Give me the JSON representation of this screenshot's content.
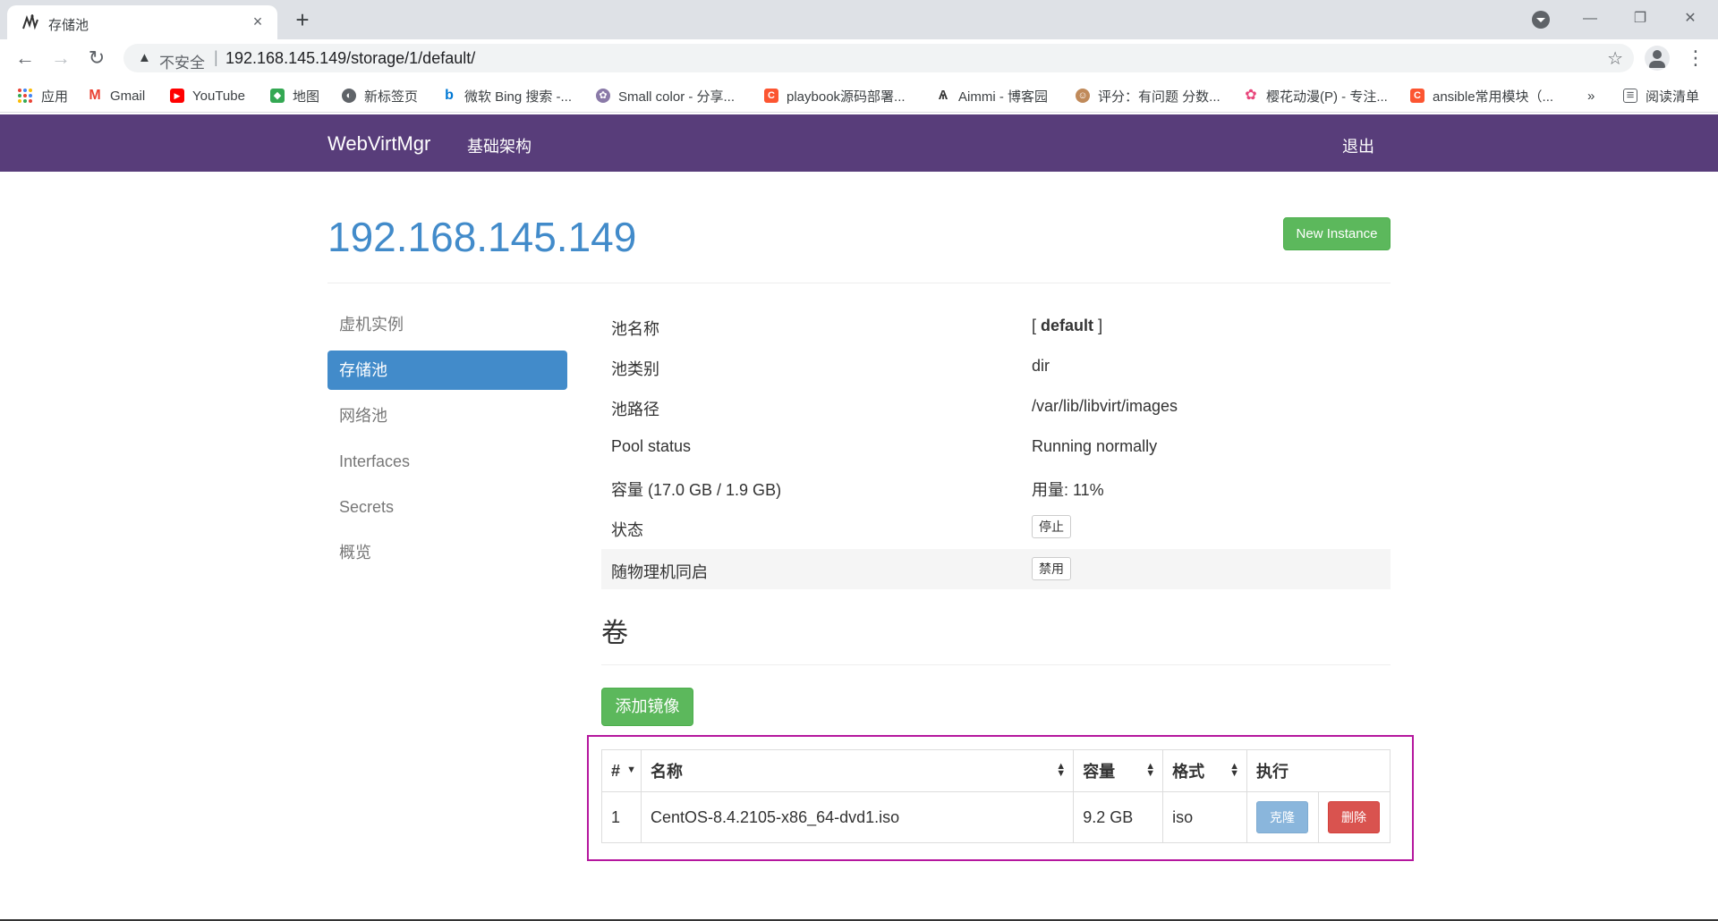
{
  "browser": {
    "tab_title": "存储池",
    "new_tab_symbol": "+",
    "close_symbol": "×",
    "address": {
      "insecure_label": "不安全",
      "separator": "|",
      "url": "192.168.145.149/storage/1/default/"
    },
    "bookmarks": [
      {
        "label": "应用",
        "icon": "apps-grid-icon"
      },
      {
        "label": "Gmail",
        "icon": "gmail-icon",
        "color": "#ea4335"
      },
      {
        "label": "YouTube",
        "icon": "youtube-icon",
        "color": "#ff0000"
      },
      {
        "label": "地图",
        "icon": "maps-icon",
        "color": "#34a853"
      },
      {
        "label": "新标签页",
        "icon": "globe-icon",
        "color": "#5f6368"
      },
      {
        "label": "微软 Bing 搜索 -...",
        "icon": "bing-icon",
        "color": "#0078d4"
      },
      {
        "label": "Small color - 分享...",
        "icon": "small-color-icon",
        "color": "#8a7aa8"
      },
      {
        "label": "playbook源码部署...",
        "icon": "csdn-icon",
        "color": "#fc5531"
      },
      {
        "label": "Aimmi - 博客园",
        "icon": "cnblogs-icon",
        "color": "#333333"
      },
      {
        "label": "评分：有问题 分数...",
        "icon": "avatar-icon",
        "color": "#c08a5a"
      },
      {
        "label": "樱花动漫(P) - 专注...",
        "icon": "sakura-icon",
        "color": "#e8457a"
      },
      {
        "label": "ansible常用模块（...",
        "icon": "csdn-icon",
        "color": "#fc5531"
      }
    ],
    "bookmarks_overflow": "»",
    "reading_list": "阅读清单"
  },
  "navbar": {
    "brand": "WebVirtMgr",
    "infra": "基础架构",
    "logout": "退出",
    "bg_color": "#583d7a"
  },
  "page": {
    "title": "192.168.145.149",
    "new_instance": "New Instance"
  },
  "sidebar": {
    "items": [
      {
        "label": "虚机实例",
        "active": false
      },
      {
        "label": "存储池",
        "active": true
      },
      {
        "label": "网络池",
        "active": false
      },
      {
        "label": "Interfaces",
        "active": false
      },
      {
        "label": "Secrets",
        "active": false
      },
      {
        "label": "概览",
        "active": false
      }
    ]
  },
  "pool_info": {
    "name_label": "池名称",
    "name_value_prefix": "[",
    "name_value": "default",
    "name_value_suffix": "]",
    "type_label": "池类别",
    "type_value": "dir",
    "path_label": "池路径",
    "path_value": "/var/lib/libvirt/images",
    "status_label": "Pool status",
    "status_value": "Running normally",
    "capacity_label": "容量 (17.0 GB / 1.9 GB)",
    "usage_value": "用量: 11%",
    "state_label": "状态",
    "stop_button": "停止",
    "autostart_label": "随物理机同启",
    "disable_button": "禁用"
  },
  "volumes": {
    "title": "卷",
    "add_button": "添加镜像",
    "columns": [
      "#",
      "名称",
      "容量",
      "格式",
      "执行"
    ],
    "rows": [
      {
        "index": "1",
        "name": "CentOS-8.4.2105-x86_64-dvd1.iso",
        "size": "9.2 GB",
        "format": "iso",
        "clone": "克隆",
        "delete": "删除"
      }
    ]
  }
}
